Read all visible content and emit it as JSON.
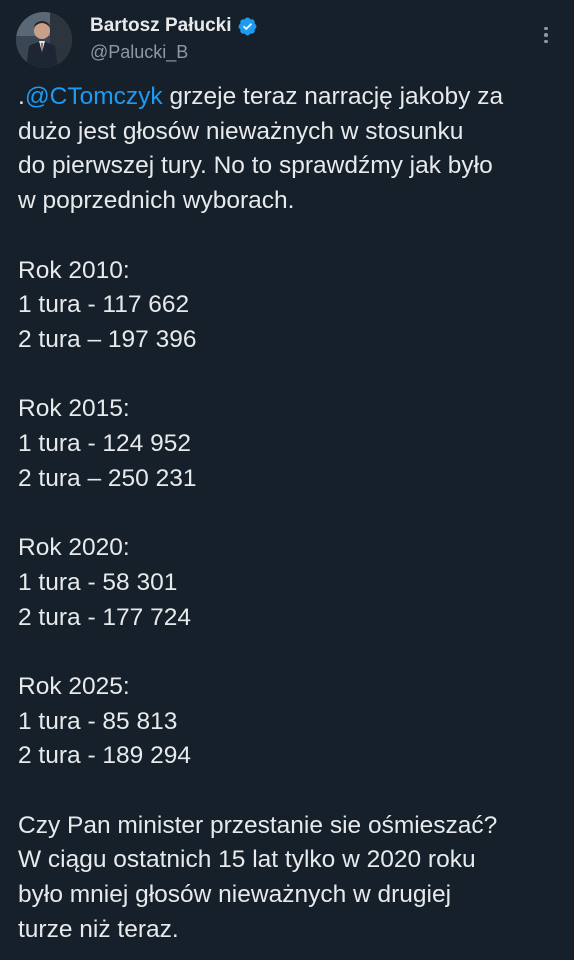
{
  "author": {
    "display_name": "Bartosz Pałucki",
    "handle": "@Palucki_B",
    "verified_badge_color": "#1d9bf0",
    "verified_icon": "verified-badge-icon",
    "more_icon": "more-options-icon"
  },
  "tweet": {
    "intro": {
      "prefix": ".",
      "mention": "@CTomczyk",
      "line1_rest": " grzeje teraz narrację jakoby za",
      "line2": "dużo jest głosów nieważnych w stosunku",
      "line3": "do pierwszej tury. No to sprawdźmy jak było",
      "line4": "w poprzednich wyborach."
    },
    "years": [
      {
        "heading": "Rok 2010:",
        "round1": "1 tura - 117 662",
        "round2": "2 tura – 197 396"
      },
      {
        "heading": "Rok 2015:",
        "round1": "1 tura - 124 952",
        "round2": "2 tura – 250 231"
      },
      {
        "heading": "Rok 2020:",
        "round1": "1 tura - 58 301",
        "round2": "2 tura - 177 724"
      },
      {
        "heading": "Rok 2025:",
        "round1": "1 tura - 85 813",
        "round2": "2 tura - 189 294"
      }
    ],
    "closing": {
      "line1": "Czy Pan minister przestanie sie ośmieszać?",
      "line2": "W ciągu ostatnich 15 lat tylko w 2020 roku",
      "line3": "było mniej głosów nieważnych w drugiej",
      "line4": "turze niż teraz."
    }
  },
  "colors": {
    "background": "#15202b",
    "text": "#e7e9ea",
    "secondary_text": "#8b98a5",
    "link": "#1d9bf0"
  }
}
